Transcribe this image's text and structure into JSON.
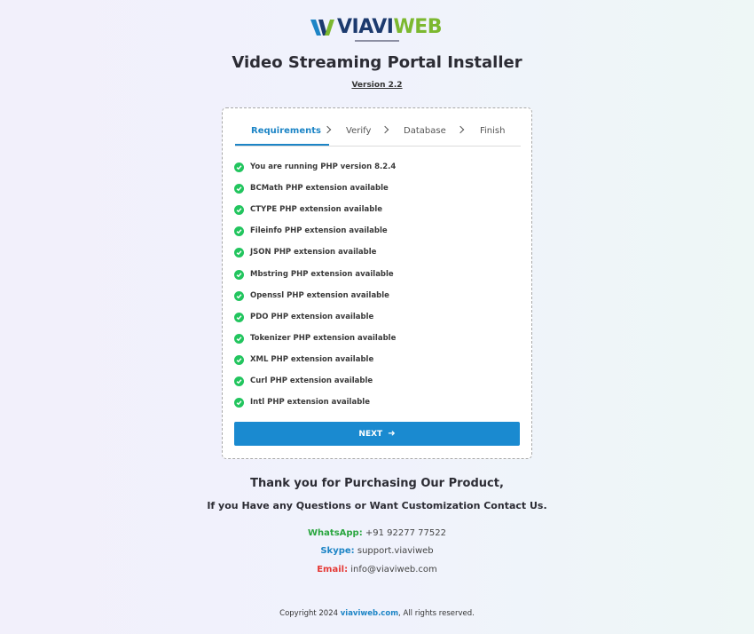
{
  "brand": {
    "logo_text_via": "VIAVI",
    "logo_text_web": "WEB",
    "colors": {
      "via": "#1c3a6e",
      "web": "#7cb82f",
      "accent": "#1d85c6",
      "success": "#22c55e"
    }
  },
  "header": {
    "title": "Video Streaming Portal Installer",
    "version": "Version 2.2"
  },
  "wizard": {
    "tabs": [
      {
        "label": "Requirements",
        "active": true
      },
      {
        "label": "Verify",
        "active": false
      },
      {
        "label": "Database",
        "active": false
      },
      {
        "label": "Finish",
        "active": false
      }
    ],
    "requirements": [
      "You are running PHP version 8.2.4",
      "BCMath PHP extension available",
      "CTYPE PHP extension available",
      "Fileinfo PHP extension available",
      "JSON PHP extension available",
      "Mbstring PHP extension available",
      "Openssl PHP extension available",
      "PDO PHP extension available",
      "Tokenizer PHP extension available",
      "XML PHP extension available",
      "Curl PHP extension available",
      "Intl PHP extension available"
    ],
    "next_label": "NEXT",
    "next_icon": "arrow-right-icon"
  },
  "contact": {
    "thanks": "Thank you for Purchasing Our Product,",
    "line": "If you Have any Questions or Want Customization Contact Us.",
    "whatsapp_label": "WhatsApp:",
    "whatsapp_value": "+91 92277 77522",
    "skype_label": "Skype:",
    "skype_value": "support.viaviweb",
    "email_label": "Email:",
    "email_value": "info@viaviweb.com"
  },
  "footer": {
    "prefix": "Copyright 2024",
    "link": "viaviweb.com",
    "suffix": ", All rights reserved."
  }
}
